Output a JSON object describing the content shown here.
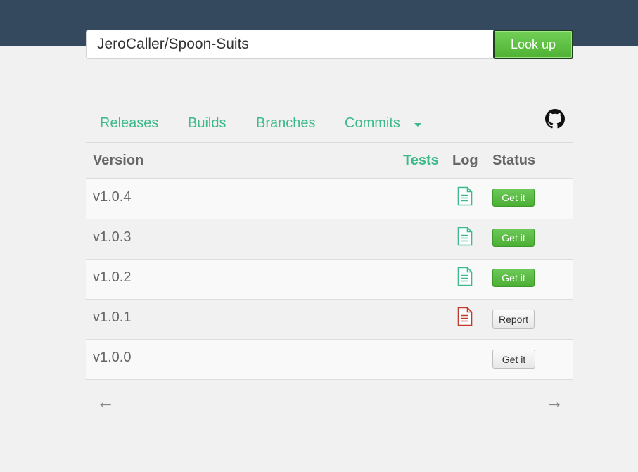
{
  "search": {
    "value": "JeroCaller/Spoon-Suits",
    "button_label": "Look up"
  },
  "nav": {
    "items": [
      "Releases",
      "Builds",
      "Branches",
      "Commits"
    ],
    "github_icon": "github-icon"
  },
  "table": {
    "headers": {
      "version": "Version",
      "tests": "Tests",
      "log": "Log",
      "status": "Status"
    },
    "rows": [
      {
        "version": "v1.0.4",
        "log": "ok",
        "status_label": "Get it",
        "status_style": "success"
      },
      {
        "version": "v1.0.3",
        "log": "ok",
        "status_label": "Get it",
        "status_style": "success"
      },
      {
        "version": "v1.0.2",
        "log": "ok",
        "status_label": "Get it",
        "status_style": "success"
      },
      {
        "version": "v1.0.1",
        "log": "error",
        "status_label": "Report",
        "status_style": "default"
      },
      {
        "version": "v1.0.0",
        "log": "none",
        "status_label": "Get it",
        "status_style": "default"
      }
    ]
  },
  "pager": {
    "prev": "←",
    "next": "→"
  },
  "colors": {
    "topbar": "#34495e",
    "accent": "#3cba8a",
    "success": "#5cb944",
    "log_ok": "#3cba8a",
    "log_error": "#c0392b"
  }
}
